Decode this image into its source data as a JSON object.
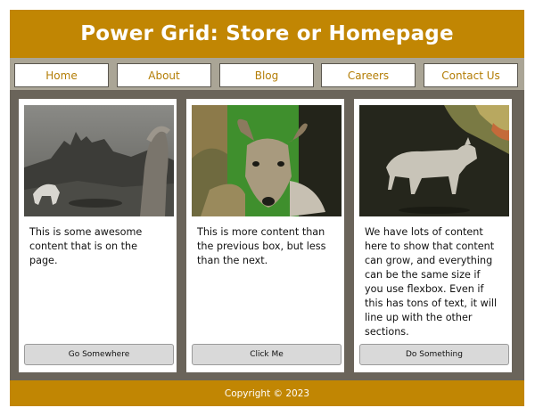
{
  "header": {
    "title": "Power Grid: Store or Homepage"
  },
  "nav": {
    "items": [
      {
        "label": "Home"
      },
      {
        "label": "About"
      },
      {
        "label": "Blog"
      },
      {
        "label": "Careers"
      },
      {
        "label": "Contact Us"
      }
    ]
  },
  "cards": [
    {
      "text": "This is some awesome content that is on the page.",
      "button": "Go Somewhere",
      "image": "castle-horse-photo"
    },
    {
      "text": "This is more content than the previous box, but less than the next.",
      "button": "Click Me",
      "image": "deer-photo"
    },
    {
      "text": "We have lots of content here to show that content can grow, and everything can be the same size if you use flexbox. Even if this has tons of text, it will line up with the other sections.",
      "button": "Do Something",
      "image": "goat-photo"
    }
  ],
  "footer": {
    "text": "Copyright © 2023"
  },
  "colors": {
    "accent": "#c18603",
    "nav_link": "#b37d05",
    "background": "#6a645a",
    "nav_bar": "#aaa596"
  }
}
